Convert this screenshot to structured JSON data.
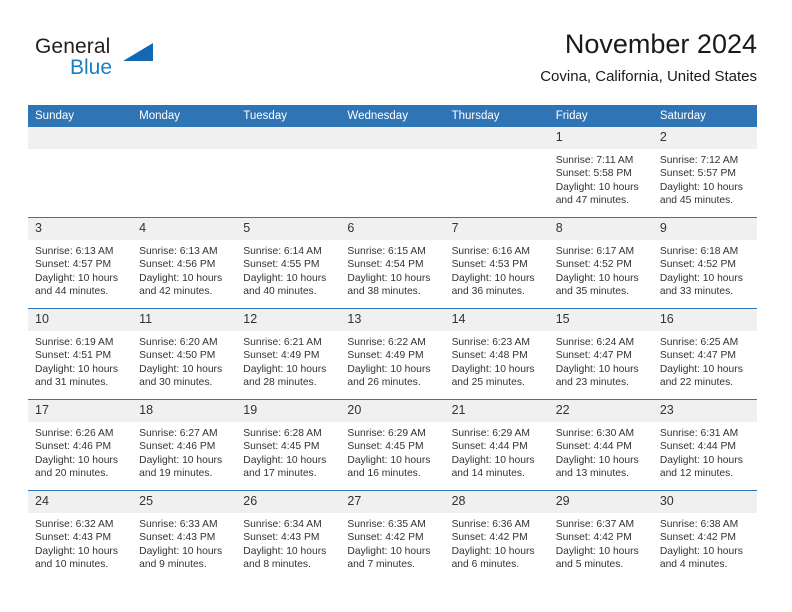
{
  "brand": {
    "name_part1": "General",
    "name_part2": "Blue",
    "triangle_color": "#1268b3",
    "blue_text_color": "#1b7fc4"
  },
  "header": {
    "title": "November 2024",
    "subtitle": "Covina, California, United States"
  },
  "theme": {
    "header_blue": "#2f75b5",
    "daynum_background": "#f0f0f0",
    "text_color": "#333333"
  },
  "weekday_headers": [
    "Sunday",
    "Monday",
    "Tuesday",
    "Wednesday",
    "Thursday",
    "Friday",
    "Saturday"
  ],
  "weeks": [
    [
      {
        "day": "",
        "sunrise": "",
        "sunset": "",
        "daylight_line1": "",
        "daylight_line2": ""
      },
      {
        "day": "",
        "sunrise": "",
        "sunset": "",
        "daylight_line1": "",
        "daylight_line2": ""
      },
      {
        "day": "",
        "sunrise": "",
        "sunset": "",
        "daylight_line1": "",
        "daylight_line2": ""
      },
      {
        "day": "",
        "sunrise": "",
        "sunset": "",
        "daylight_line1": "",
        "daylight_line2": ""
      },
      {
        "day": "",
        "sunrise": "",
        "sunset": "",
        "daylight_line1": "",
        "daylight_line2": ""
      },
      {
        "day": "1",
        "sunrise": "Sunrise: 7:11 AM",
        "sunset": "Sunset: 5:58 PM",
        "daylight_line1": "Daylight: 10 hours",
        "daylight_line2": "and 47 minutes."
      },
      {
        "day": "2",
        "sunrise": "Sunrise: 7:12 AM",
        "sunset": "Sunset: 5:57 PM",
        "daylight_line1": "Daylight: 10 hours",
        "daylight_line2": "and 45 minutes."
      }
    ],
    [
      {
        "day": "3",
        "sunrise": "Sunrise: 6:13 AM",
        "sunset": "Sunset: 4:57 PM",
        "daylight_line1": "Daylight: 10 hours",
        "daylight_line2": "and 44 minutes."
      },
      {
        "day": "4",
        "sunrise": "Sunrise: 6:13 AM",
        "sunset": "Sunset: 4:56 PM",
        "daylight_line1": "Daylight: 10 hours",
        "daylight_line2": "and 42 minutes."
      },
      {
        "day": "5",
        "sunrise": "Sunrise: 6:14 AM",
        "sunset": "Sunset: 4:55 PM",
        "daylight_line1": "Daylight: 10 hours",
        "daylight_line2": "and 40 minutes."
      },
      {
        "day": "6",
        "sunrise": "Sunrise: 6:15 AM",
        "sunset": "Sunset: 4:54 PM",
        "daylight_line1": "Daylight: 10 hours",
        "daylight_line2": "and 38 minutes."
      },
      {
        "day": "7",
        "sunrise": "Sunrise: 6:16 AM",
        "sunset": "Sunset: 4:53 PM",
        "daylight_line1": "Daylight: 10 hours",
        "daylight_line2": "and 36 minutes."
      },
      {
        "day": "8",
        "sunrise": "Sunrise: 6:17 AM",
        "sunset": "Sunset: 4:52 PM",
        "daylight_line1": "Daylight: 10 hours",
        "daylight_line2": "and 35 minutes."
      },
      {
        "day": "9",
        "sunrise": "Sunrise: 6:18 AM",
        "sunset": "Sunset: 4:52 PM",
        "daylight_line1": "Daylight: 10 hours",
        "daylight_line2": "and 33 minutes."
      }
    ],
    [
      {
        "day": "10",
        "sunrise": "Sunrise: 6:19 AM",
        "sunset": "Sunset: 4:51 PM",
        "daylight_line1": "Daylight: 10 hours",
        "daylight_line2": "and 31 minutes."
      },
      {
        "day": "11",
        "sunrise": "Sunrise: 6:20 AM",
        "sunset": "Sunset: 4:50 PM",
        "daylight_line1": "Daylight: 10 hours",
        "daylight_line2": "and 30 minutes."
      },
      {
        "day": "12",
        "sunrise": "Sunrise: 6:21 AM",
        "sunset": "Sunset: 4:49 PM",
        "daylight_line1": "Daylight: 10 hours",
        "daylight_line2": "and 28 minutes."
      },
      {
        "day": "13",
        "sunrise": "Sunrise: 6:22 AM",
        "sunset": "Sunset: 4:49 PM",
        "daylight_line1": "Daylight: 10 hours",
        "daylight_line2": "and 26 minutes."
      },
      {
        "day": "14",
        "sunrise": "Sunrise: 6:23 AM",
        "sunset": "Sunset: 4:48 PM",
        "daylight_line1": "Daylight: 10 hours",
        "daylight_line2": "and 25 minutes."
      },
      {
        "day": "15",
        "sunrise": "Sunrise: 6:24 AM",
        "sunset": "Sunset: 4:47 PM",
        "daylight_line1": "Daylight: 10 hours",
        "daylight_line2": "and 23 minutes."
      },
      {
        "day": "16",
        "sunrise": "Sunrise: 6:25 AM",
        "sunset": "Sunset: 4:47 PM",
        "daylight_line1": "Daylight: 10 hours",
        "daylight_line2": "and 22 minutes."
      }
    ],
    [
      {
        "day": "17",
        "sunrise": "Sunrise: 6:26 AM",
        "sunset": "Sunset: 4:46 PM",
        "daylight_line1": "Daylight: 10 hours",
        "daylight_line2": "and 20 minutes."
      },
      {
        "day": "18",
        "sunrise": "Sunrise: 6:27 AM",
        "sunset": "Sunset: 4:46 PM",
        "daylight_line1": "Daylight: 10 hours",
        "daylight_line2": "and 19 minutes."
      },
      {
        "day": "19",
        "sunrise": "Sunrise: 6:28 AM",
        "sunset": "Sunset: 4:45 PM",
        "daylight_line1": "Daylight: 10 hours",
        "daylight_line2": "and 17 minutes."
      },
      {
        "day": "20",
        "sunrise": "Sunrise: 6:29 AM",
        "sunset": "Sunset: 4:45 PM",
        "daylight_line1": "Daylight: 10 hours",
        "daylight_line2": "and 16 minutes."
      },
      {
        "day": "21",
        "sunrise": "Sunrise: 6:29 AM",
        "sunset": "Sunset: 4:44 PM",
        "daylight_line1": "Daylight: 10 hours",
        "daylight_line2": "and 14 minutes."
      },
      {
        "day": "22",
        "sunrise": "Sunrise: 6:30 AM",
        "sunset": "Sunset: 4:44 PM",
        "daylight_line1": "Daylight: 10 hours",
        "daylight_line2": "and 13 minutes."
      },
      {
        "day": "23",
        "sunrise": "Sunrise: 6:31 AM",
        "sunset": "Sunset: 4:44 PM",
        "daylight_line1": "Daylight: 10 hours",
        "daylight_line2": "and 12 minutes."
      }
    ],
    [
      {
        "day": "24",
        "sunrise": "Sunrise: 6:32 AM",
        "sunset": "Sunset: 4:43 PM",
        "daylight_line1": "Daylight: 10 hours",
        "daylight_line2": "and 10 minutes."
      },
      {
        "day": "25",
        "sunrise": "Sunrise: 6:33 AM",
        "sunset": "Sunset: 4:43 PM",
        "daylight_line1": "Daylight: 10 hours",
        "daylight_line2": "and 9 minutes."
      },
      {
        "day": "26",
        "sunrise": "Sunrise: 6:34 AM",
        "sunset": "Sunset: 4:43 PM",
        "daylight_line1": "Daylight: 10 hours",
        "daylight_line2": "and 8 minutes."
      },
      {
        "day": "27",
        "sunrise": "Sunrise: 6:35 AM",
        "sunset": "Sunset: 4:42 PM",
        "daylight_line1": "Daylight: 10 hours",
        "daylight_line2": "and 7 minutes."
      },
      {
        "day": "28",
        "sunrise": "Sunrise: 6:36 AM",
        "sunset": "Sunset: 4:42 PM",
        "daylight_line1": "Daylight: 10 hours",
        "daylight_line2": "and 6 minutes."
      },
      {
        "day": "29",
        "sunrise": "Sunrise: 6:37 AM",
        "sunset": "Sunset: 4:42 PM",
        "daylight_line1": "Daylight: 10 hours",
        "daylight_line2": "and 5 minutes."
      },
      {
        "day": "30",
        "sunrise": "Sunrise: 6:38 AM",
        "sunset": "Sunset: 4:42 PM",
        "daylight_line1": "Daylight: 10 hours",
        "daylight_line2": "and 4 minutes."
      }
    ]
  ]
}
